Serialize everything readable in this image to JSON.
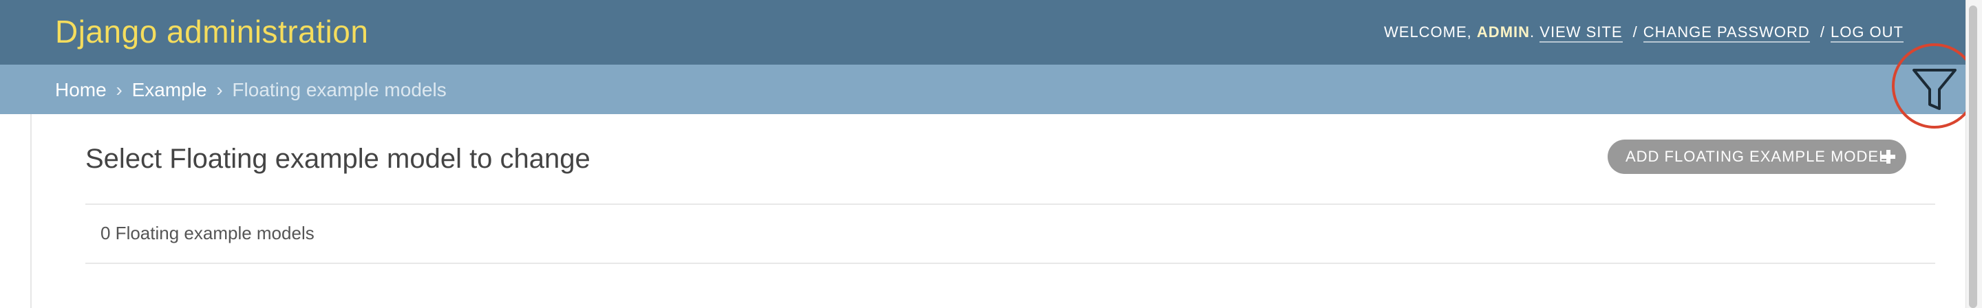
{
  "header": {
    "branding": "Django administration",
    "welcome_prefix": "WELCOME,",
    "username": "ADMIN",
    "username_suffix": ".",
    "view_site": "VIEW SITE",
    "separator": "/",
    "change_password": "CHANGE PASSWORD",
    "log_out": "LOG OUT"
  },
  "breadcrumbs": {
    "home": "Home",
    "separator": "›",
    "app": "Example",
    "current": "Floating example models"
  },
  "content": {
    "title": "Select Floating example model to change",
    "add_button_label": "ADD FLOATING EXAMPLE MODEL",
    "result_count": "0 Floating example models"
  },
  "icons": {
    "filter": "filter-funnel-icon",
    "add": "plus-icon"
  },
  "colors": {
    "header_bg": "#4f7490",
    "branding": "#f5dd5d",
    "breadcrumbs_bg": "#83a8c4",
    "highlight_circle": "#d9452f",
    "add_button_bg": "#999999"
  }
}
